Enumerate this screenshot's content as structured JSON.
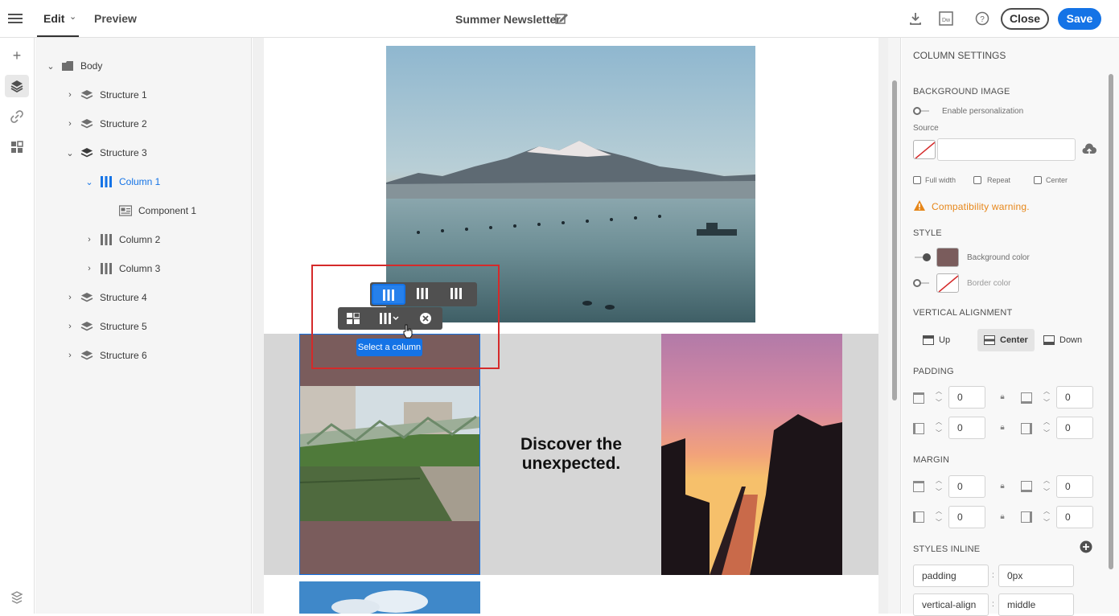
{
  "header": {
    "tab_edit": "Edit",
    "tab_preview": "Preview",
    "title": "Summer Newsletter",
    "close_label": "Close",
    "save_label": "Save"
  },
  "tree": {
    "root": "Body",
    "items": [
      {
        "label": "Structure 1"
      },
      {
        "label": "Structure 2"
      },
      {
        "label": "Structure 3"
      },
      {
        "label": "Column 1"
      },
      {
        "label": "Component 1"
      },
      {
        "label": "Column 2"
      },
      {
        "label": "Column 3"
      },
      {
        "label": "Structure 4"
      },
      {
        "label": "Structure 5"
      },
      {
        "label": "Structure 6"
      }
    ]
  },
  "canvas": {
    "headline": "Discover the unexpected.",
    "tooltip": "Select a column"
  },
  "panel": {
    "title": "COLUMN SETTINGS",
    "background_image": "BACKGROUND IMAGE",
    "enable_personalization": "Enable personalization",
    "source": "Source",
    "full_width": "Full width",
    "repeat": "Repeat",
    "center": "Center",
    "warning": "Compatibility warning.",
    "style": "STYLE",
    "background_color": "Background color",
    "border_color": "Border color",
    "vertical_alignment": "VERTICAL ALIGNMENT",
    "valign_up": "Up",
    "valign_center": "Center",
    "valign_down": "Down",
    "padding": "PADDING",
    "margin": "MARGIN",
    "styles_inline": "STYLES INLINE",
    "pad_top": "0",
    "pad_bottom": "0",
    "pad_left": "0",
    "pad_right": "0",
    "margin_top": "0",
    "margin_bottom": "0",
    "margin_left": "0",
    "margin_right": "0",
    "inline_1_prop": "padding",
    "inline_1_val": "0px",
    "inline_2_prop": "vertical-align",
    "inline_2_val": "middle",
    "colon": ":"
  },
  "colors": {
    "accent": "#1473e6",
    "background_color_swatch": "#7a5c5c",
    "warning": "#e68619",
    "selection_frame": "#d52a2a"
  }
}
